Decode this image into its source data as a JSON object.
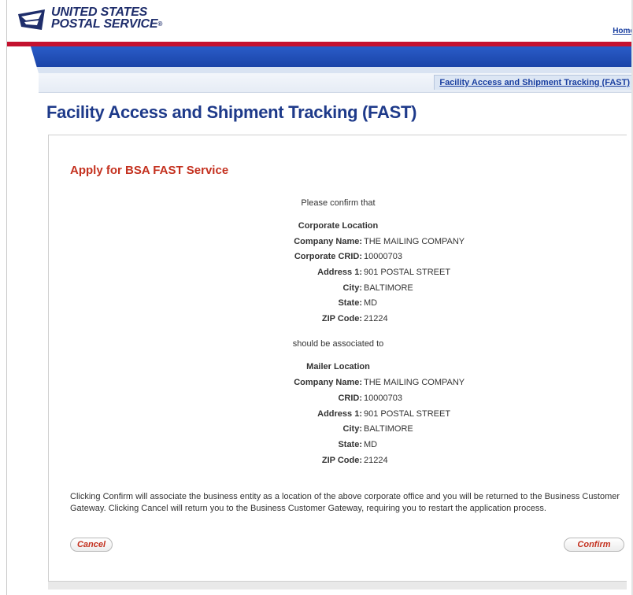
{
  "header": {
    "brand_line1": "UNITED STATES",
    "brand_line2": "POSTAL SERVICE",
    "brand_reg": "®",
    "home_link": "Home",
    "breadcrumb_tab": "Facility Access and Shipment Tracking (FAST)"
  },
  "page": {
    "title": "Facility Access and Shipment Tracking (FAST)"
  },
  "panel": {
    "section_title": "Apply for BSA FAST Service",
    "intro": "Please confirm that",
    "corporate": {
      "heading": "Corporate Location",
      "rows": [
        {
          "label": "Company Name:",
          "value": "THE MAILING COMPANY"
        },
        {
          "label": "Corporate CRID:",
          "value": "10000703"
        },
        {
          "label": "Address 1:",
          "value": "901 POSTAL STREET"
        },
        {
          "label": "City:",
          "value": "BALTIMORE"
        },
        {
          "label": "State:",
          "value": "MD"
        },
        {
          "label": "ZIP Code:",
          "value": "21224"
        }
      ]
    },
    "connector": "should be associated to",
    "mailer": {
      "heading": "Mailer Location",
      "rows": [
        {
          "label": "Company Name:",
          "value": "THE MAILING COMPANY"
        },
        {
          "label": "CRID:",
          "value": "10000703"
        },
        {
          "label": "Address 1:",
          "value": "901 POSTAL STREET"
        },
        {
          "label": "City:",
          "value": "BALTIMORE"
        },
        {
          "label": "State:",
          "value": "MD"
        },
        {
          "label": "ZIP Code:",
          "value": "21224"
        }
      ]
    },
    "note": "Clicking Confirm will associate the business entity as a location of the above corporate office and you will be returned to the Business Customer Gateway. Clicking Cancel will return you to the Business Customer Gateway, requiring you to restart the application process.",
    "cancel_label": "Cancel",
    "confirm_label": "Confirm"
  },
  "colors": {
    "usps_red": "#c4122f",
    "usps_blue": "#1a44a8",
    "title_blue": "#1e3a8a",
    "section_red": "#c4311f"
  },
  "icons": {
    "logo": "usps-eagle-icon"
  }
}
